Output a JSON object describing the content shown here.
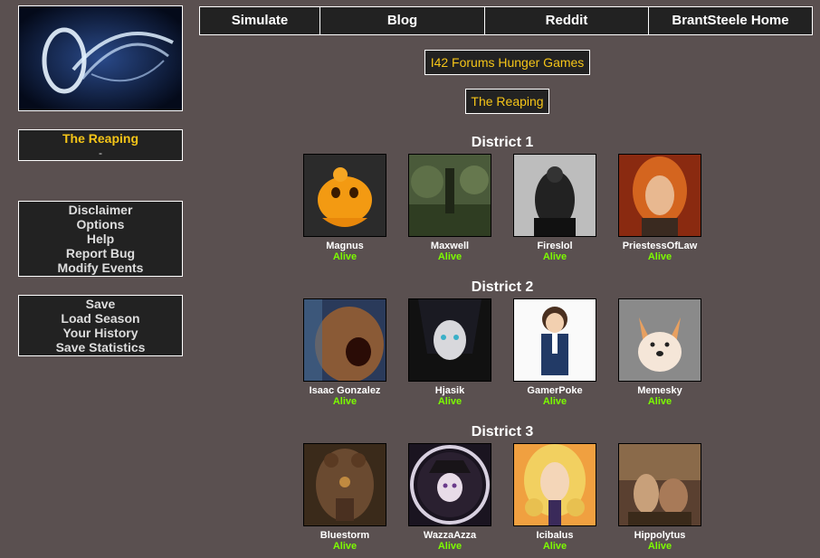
{
  "sidebar": {
    "status": {
      "title": "The Reaping",
      "subtitle": "-"
    },
    "menu1": [
      "Disclaimer",
      "Options",
      "Help",
      "Report Bug",
      "Modify Events"
    ],
    "menu2": [
      "Save",
      "Load Season",
      "Your History",
      "Save Statistics"
    ]
  },
  "nav": [
    "Simulate",
    "Blog",
    "Reddit",
    "BrantSteele Home"
  ],
  "game_title": "I42 Forums Hunger Games",
  "phase_label": "The Reaping",
  "districts": [
    {
      "title": "District 1",
      "tributes": [
        {
          "name": "Magnus",
          "status": "Alive"
        },
        {
          "name": "Maxwell",
          "status": "Alive"
        },
        {
          "name": "Fireslol",
          "status": "Alive"
        },
        {
          "name": "PriestessOfLaw",
          "status": "Alive"
        }
      ]
    },
    {
      "title": "District 2",
      "tributes": [
        {
          "name": "Isaac Gonzalez",
          "status": "Alive"
        },
        {
          "name": "Hjasik",
          "status": "Alive"
        },
        {
          "name": "GamerPoke",
          "status": "Alive"
        },
        {
          "name": "Memesky",
          "status": "Alive"
        }
      ]
    },
    {
      "title": "District 3",
      "tributes": [
        {
          "name": "Bluestorm",
          "status": "Alive"
        },
        {
          "name": "WazzaAzza",
          "status": "Alive"
        },
        {
          "name": "Icibalus",
          "status": "Alive"
        },
        {
          "name": "Hippolytus",
          "status": "Alive"
        }
      ]
    }
  ],
  "colors": {
    "background": "#5a5050",
    "panel": "#222222",
    "accent": "#f5c518",
    "alive": "#7cfc00"
  }
}
